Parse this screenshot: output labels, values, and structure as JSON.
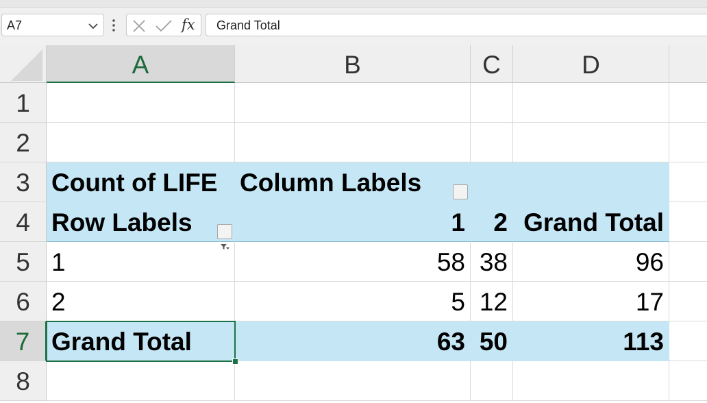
{
  "formula_bar": {
    "name_box": "A7",
    "formula": "Grand Total",
    "fx_label": "fx"
  },
  "columns": [
    "A",
    "B",
    "C",
    "D"
  ],
  "rows": [
    "1",
    "2",
    "3",
    "4",
    "5",
    "6",
    "7",
    "8"
  ],
  "pivot": {
    "value_field": "Count of LIFE",
    "column_labels": "Column Labels",
    "row_labels": "Row Labels",
    "col_keys": [
      "1",
      "2"
    ],
    "grand_total_header": "Grand Total",
    "rows": [
      {
        "label": "1",
        "v1": "58",
        "v2": "38",
        "total": "96"
      },
      {
        "label": "2",
        "v1": "5",
        "v2": "12",
        "total": "17"
      }
    ],
    "grand_total": {
      "label": "Grand Total",
      "v1": "63",
      "v2": "50",
      "total": "113"
    }
  },
  "colors": {
    "pivot_fill": "#c5e6f4",
    "selection_accent": "#1e7145"
  }
}
